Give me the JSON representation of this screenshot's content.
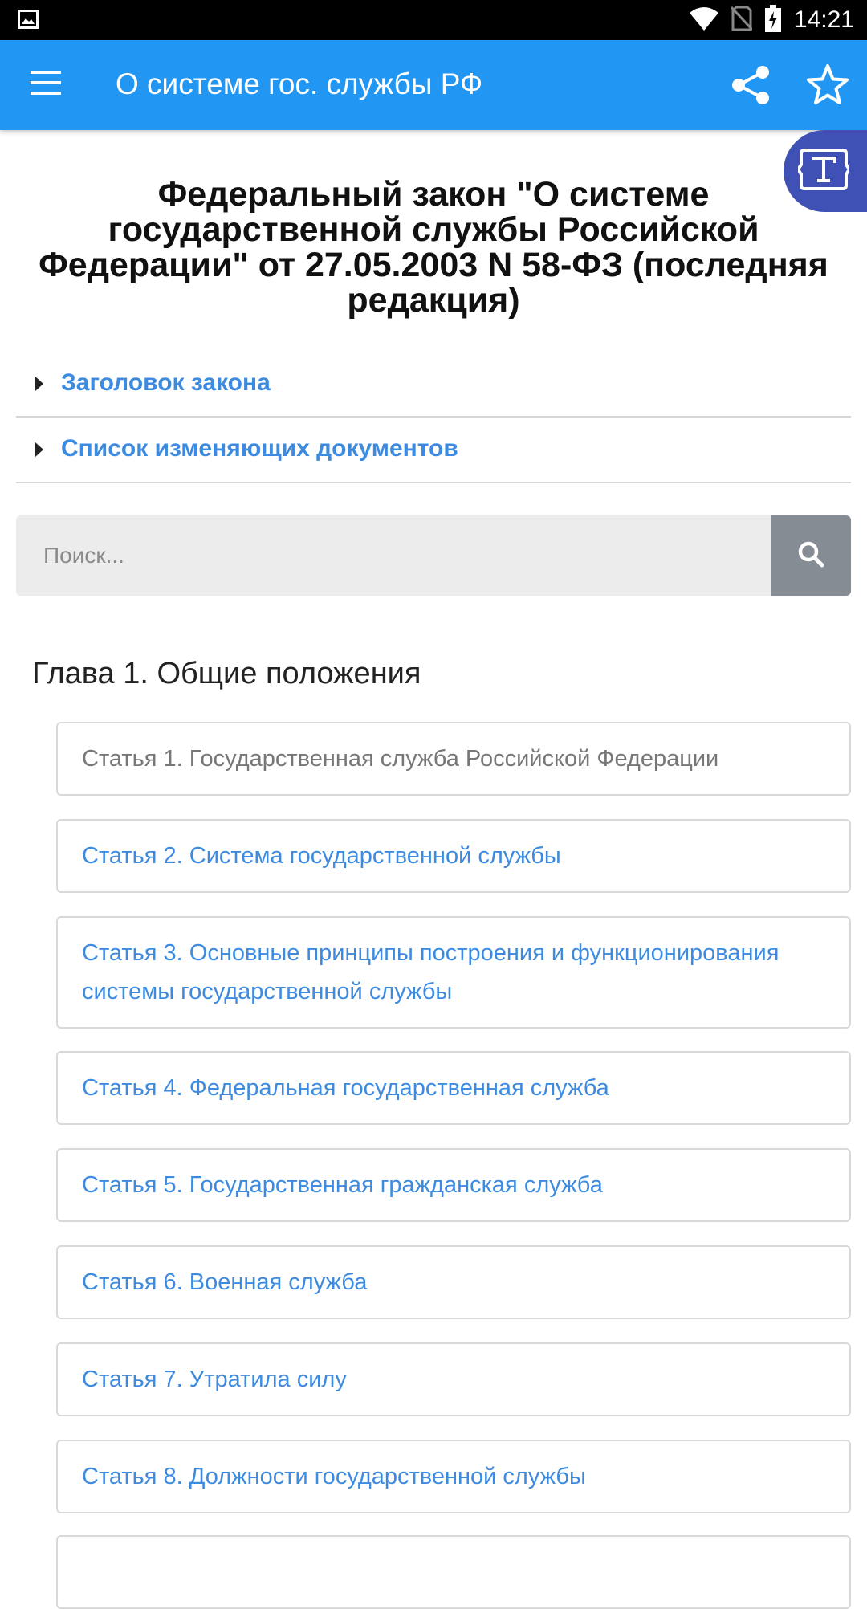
{
  "status_bar": {
    "time": "14:21",
    "icons": [
      "image-icon",
      "wifi-icon",
      "no-sim-icon",
      "battery-charging-icon"
    ]
  },
  "app_bar": {
    "title": "О системе гос. службы РФ",
    "icons": [
      "menu-icon",
      "share-icon",
      "star-icon"
    ],
    "color": "#2196f3"
  },
  "fab": {
    "icon": "text-format-icon",
    "color": "#3f51b5"
  },
  "document": {
    "title": "Федеральный закон \"О системе государственной службы Российской Федерации\" от 27.05.2003 N 58-ФЗ (последняя редакция)"
  },
  "expanders": [
    {
      "label": "Заголовок закона"
    },
    {
      "label": "Список изменяющих документов"
    }
  ],
  "search": {
    "placeholder": "Поиск...",
    "icon": "search-icon"
  },
  "chapter": {
    "title": "Глава 1. Общие положения"
  },
  "articles": [
    {
      "label": "Статья 1. Государственная служба Российской Федерации"
    },
    {
      "label": "Статья 2. Система государственной службы"
    },
    {
      "label": "Статья 3. Основные принципы построения и функционирования системы государственной службы"
    },
    {
      "label": "Статья 4. Федеральная государственная служба"
    },
    {
      "label": "Статья 5. Государственная гражданская служба"
    },
    {
      "label": "Статья 6. Военная служба"
    },
    {
      "label": "Статья 7. Утратила силу"
    },
    {
      "label": "Статья 8. Должности государственной службы"
    }
  ],
  "colors": {
    "link": "#3d8be0",
    "visited": "#777777"
  }
}
